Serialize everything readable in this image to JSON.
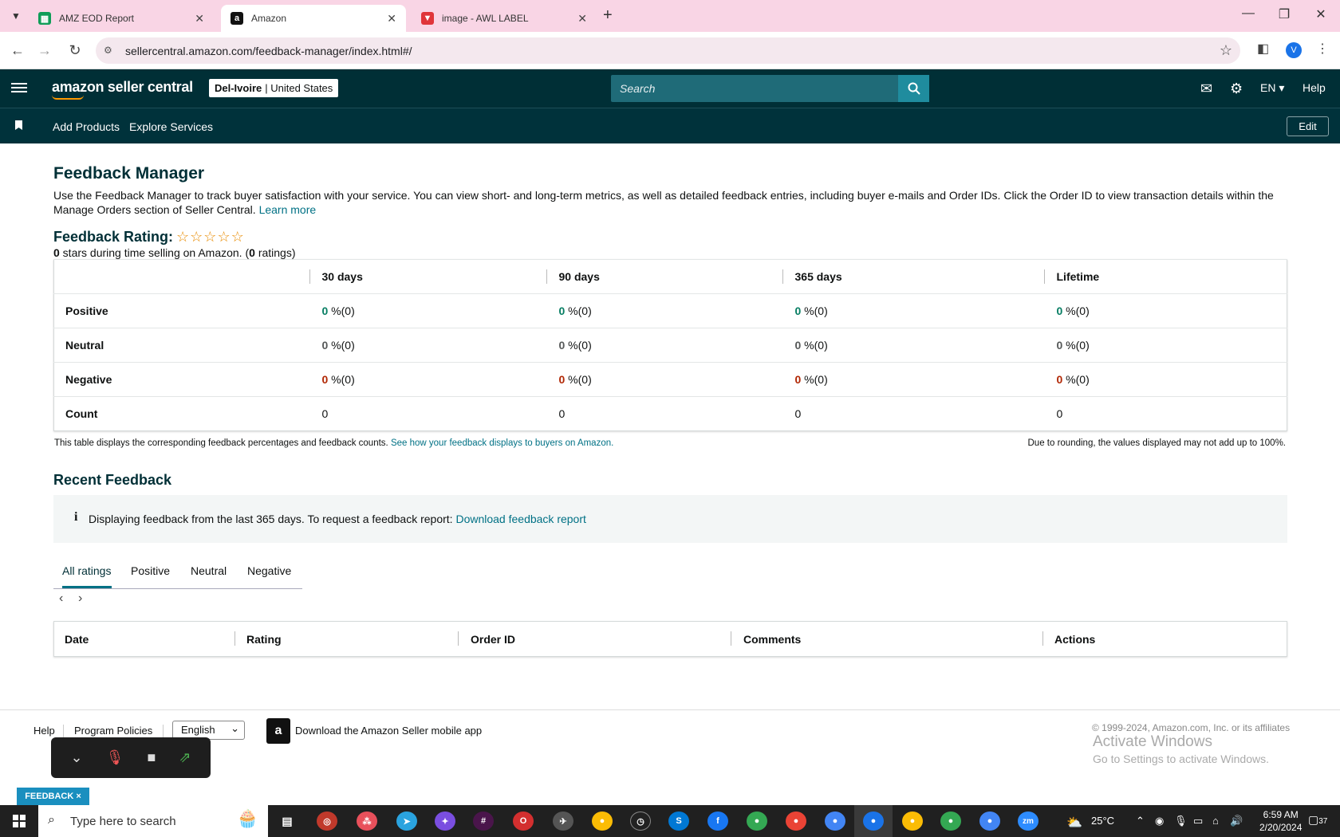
{
  "browser": {
    "tabs": [
      {
        "title": "AMZ EOD Report",
        "icon": "google-sheets-icon"
      },
      {
        "title": "Amazon",
        "icon": "amazon-icon"
      },
      {
        "title": "image - AWL LABEL",
        "icon": "vivaldi-icon"
      }
    ],
    "url": "sellercentral.amazon.com/feedback-manager/index.html#/",
    "profile_initial": "V"
  },
  "header": {
    "logo": "amazon seller central",
    "store_name": "Del-Ivoire",
    "store_region": "| United States",
    "search_placeholder": "Search",
    "language": "EN",
    "help": "Help"
  },
  "nav": {
    "links": [
      "Add Products",
      "Explore Services"
    ],
    "edit": "Edit"
  },
  "page": {
    "title": "Feedback Manager",
    "intro": "Use the Feedback Manager to track buyer satisfaction with your service. You can view short- and long-term metrics, as well as detailed feedback entries, including buyer e-mails and Order IDs. Click the Order ID to view transaction details within the Manage Orders section of Seller Central.",
    "learn_more": "Learn more",
    "rating_title": "Feedback Rating:",
    "stars": "☆☆☆☆☆",
    "rating_sub_stars": "0",
    "rating_sub_mid": " stars during time selling on Amazon. (",
    "rating_sub_count": "0",
    "rating_sub_end": " ratings)"
  },
  "feedback_table": {
    "columns": [
      "30 days",
      "90 days",
      "365 days",
      "Lifetime"
    ],
    "rows": [
      {
        "label": "Positive",
        "cells": [
          [
            "0",
            " %(0)"
          ],
          [
            "0",
            " %(0)"
          ],
          [
            "0",
            " %(0)"
          ],
          [
            "0",
            " %(0)"
          ]
        ]
      },
      {
        "label": "Neutral",
        "cells": [
          [
            "0",
            " %(0)"
          ],
          [
            "0",
            " %(0)"
          ],
          [
            "0",
            " %(0)"
          ],
          [
            "0",
            " %(0)"
          ]
        ]
      },
      {
        "label": "Negative",
        "cells": [
          [
            "0",
            " %(0)"
          ],
          [
            "0",
            " %(0)"
          ],
          [
            "0",
            " %(0)"
          ],
          [
            "0",
            " %(0)"
          ]
        ]
      },
      {
        "label": "Count",
        "cells": [
          [
            "0",
            ""
          ],
          [
            "0",
            ""
          ],
          [
            "0",
            ""
          ],
          [
            "0",
            ""
          ]
        ]
      }
    ],
    "note_left": "This table displays the corresponding feedback percentages and feedback counts.",
    "note_link": "See how your feedback displays to buyers on Amazon.",
    "note_right": "Due to rounding, the values displayed may not add up to 100%."
  },
  "recent": {
    "title": "Recent Feedback",
    "info_text": "Displaying feedback from the last 365 days. To request a feedback report:",
    "info_link": "Download feedback report",
    "tabs": [
      "All ratings",
      "Positive",
      "Neutral",
      "Negative"
    ],
    "columns": [
      "Date",
      "Rating",
      "Order ID",
      "Comments",
      "Actions"
    ]
  },
  "footer": {
    "help": "Help",
    "policies": "Program Policies",
    "language": "English",
    "app_text": "Download the Amazon Seller mobile app",
    "copyright": "© 1999-2024, Amazon.com, Inc. or its affiliates",
    "activate_title": "Activate Windows",
    "activate_sub": "Go to Settings to activate Windows."
  },
  "feedback_tab": "FEEDBACK ×",
  "taskbar": {
    "search_placeholder": "Type here to search",
    "temperature": "25°C",
    "time": "6:59 AM",
    "date": "2/20/2024",
    "notifications": "37"
  }
}
